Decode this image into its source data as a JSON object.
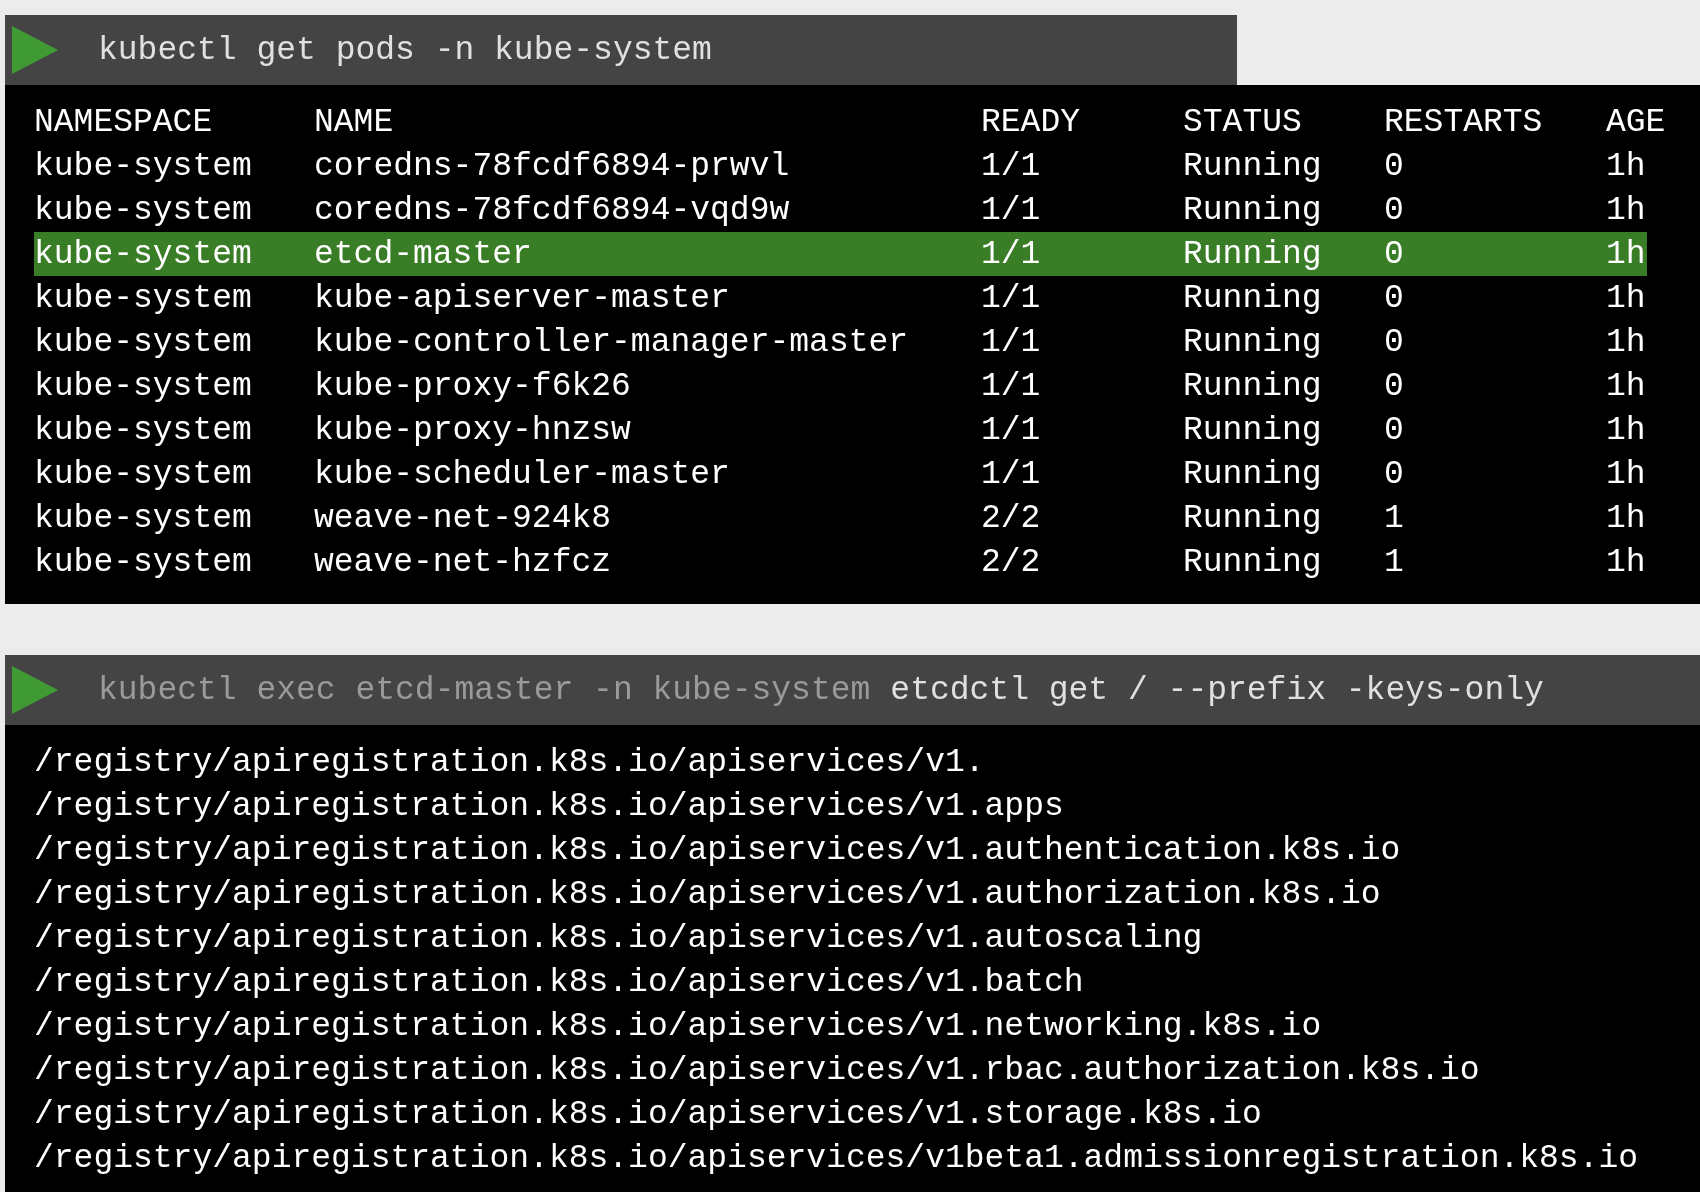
{
  "pods_command": {
    "segments": [
      {
        "text": "kubectl get pods -n kube-system",
        "dim": false
      }
    ]
  },
  "pods_table": {
    "columns": [
      "NAMESPACE",
      "NAME",
      "READY",
      "STATUS",
      "RESTARTS",
      "AGE"
    ],
    "rows": [
      {
        "cells": [
          "kube-system",
          "coredns-78fcdf6894-prwvl",
          "1/1",
          "Running",
          "0",
          "1h"
        ],
        "selected": false
      },
      {
        "cells": [
          "kube-system",
          "coredns-78fcdf6894-vqd9w",
          "1/1",
          "Running",
          "0",
          "1h"
        ],
        "selected": false
      },
      {
        "cells": [
          "kube-system",
          "etcd-master",
          "1/1",
          "Running",
          "0",
          "1h"
        ],
        "selected": true
      },
      {
        "cells": [
          "kube-system",
          "kube-apiserver-master",
          "1/1",
          "Running",
          "0",
          "1h"
        ],
        "selected": false
      },
      {
        "cells": [
          "kube-system",
          "kube-controller-manager-master",
          "1/1",
          "Running",
          "0",
          "1h"
        ],
        "selected": false
      },
      {
        "cells": [
          "kube-system",
          "kube-proxy-f6k26",
          "1/1",
          "Running",
          "0",
          "1h"
        ],
        "selected": false
      },
      {
        "cells": [
          "kube-system",
          "kube-proxy-hnzsw",
          "1/1",
          "Running",
          "0",
          "1h"
        ],
        "selected": false
      },
      {
        "cells": [
          "kube-system",
          "kube-scheduler-master",
          "1/1",
          "Running",
          "0",
          "1h"
        ],
        "selected": false
      },
      {
        "cells": [
          "kube-system",
          "weave-net-924k8",
          "2/2",
          "Running",
          "1",
          "1h"
        ],
        "selected": false
      },
      {
        "cells": [
          "kube-system",
          "weave-net-hzfcz",
          "2/2",
          "Running",
          "1",
          "1h"
        ],
        "selected": false
      }
    ]
  },
  "etcd_command": {
    "segments": [
      {
        "text": "kubectl exec etcd-master -n kube-system",
        "dim": true
      },
      {
        "text": "etcdctl get / --prefix -keys-only",
        "dim": false
      }
    ]
  },
  "etcd_output": [
    "/registry/apiregistration.k8s.io/apiservices/v1.",
    "/registry/apiregistration.k8s.io/apiservices/v1.apps",
    "/registry/apiregistration.k8s.io/apiservices/v1.authentication.k8s.io",
    "/registry/apiregistration.k8s.io/apiservices/v1.authorization.k8s.io",
    "/registry/apiregistration.k8s.io/apiservices/v1.autoscaling",
    "/registry/apiregistration.k8s.io/apiservices/v1.batch",
    "/registry/apiregistration.k8s.io/apiservices/v1.networking.k8s.io",
    "/registry/apiregistration.k8s.io/apiservices/v1.rbac.authorization.k8s.io",
    "/registry/apiregistration.k8s.io/apiservices/v1.storage.k8s.io",
    "/registry/apiregistration.k8s.io/apiservices/v1beta1.admissionregistration.k8s.io"
  ]
}
